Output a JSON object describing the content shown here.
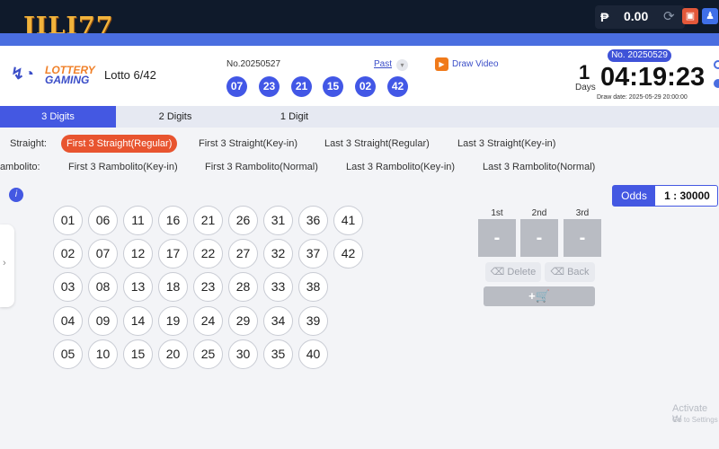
{
  "topbar": {
    "logo": "JILI77",
    "currency_symbol": "₱",
    "balance": "0.00"
  },
  "header": {
    "brand_top": "LOTTERY",
    "brand_bottom": "GAMING",
    "game_name": "Lotto 6/42",
    "draw_no": "No.20250527",
    "last_result": [
      "07",
      "23",
      "21",
      "15",
      "02",
      "42"
    ],
    "past_label": "Past",
    "draw_video_label": "Draw Video",
    "next_draw_badge": "No. 20250529",
    "days_value": "1",
    "days_label": "Days",
    "countdown": "04:19:23",
    "draw_date": "Draw date: 2025-05-29 20:00:00"
  },
  "tabs": [
    "3 Digits",
    "2 Digits",
    "1 Digit"
  ],
  "bet_types": {
    "straight_label": "Straight:",
    "straight": [
      "First 3 Straight(Regular)",
      "First 3 Straight(Key-in)",
      "Last 3 Straight(Regular)",
      "Last 3 Straight(Key-in)"
    ],
    "rambolito_label": "Rambolito:",
    "rambolito": [
      "First 3 Rambolito(Key-in)",
      "First 3 Rambolito(Normal)",
      "Last 3 Rambolito(Key-in)",
      "Last 3 Rambolito(Normal)"
    ]
  },
  "numbers": [
    [
      "01",
      "06",
      "11",
      "16",
      "21",
      "26",
      "31",
      "36",
      "41"
    ],
    [
      "02",
      "07",
      "12",
      "17",
      "22",
      "27",
      "32",
      "37",
      "42"
    ],
    [
      "03",
      "08",
      "13",
      "18",
      "23",
      "28",
      "33",
      "38"
    ],
    [
      "04",
      "09",
      "14",
      "19",
      "24",
      "29",
      "34",
      "39"
    ],
    [
      "05",
      "10",
      "15",
      "20",
      "25",
      "30",
      "35",
      "40"
    ]
  ],
  "odds": {
    "label": "Odds",
    "value": "1 : 30000"
  },
  "positions": {
    "labels": [
      "1st",
      "2nd",
      "3rd"
    ],
    "values": [
      "-",
      "-",
      "-"
    ]
  },
  "actions": {
    "delete": "Delete",
    "back": "Back",
    "add_cart": "+🛒"
  },
  "watermark": {
    "line1": "Activate W",
    "line2": "Go to Settings"
  },
  "colors": {
    "accent": "#4458e2",
    "active_option": "#e8542f",
    "ball": "#4257e6"
  }
}
